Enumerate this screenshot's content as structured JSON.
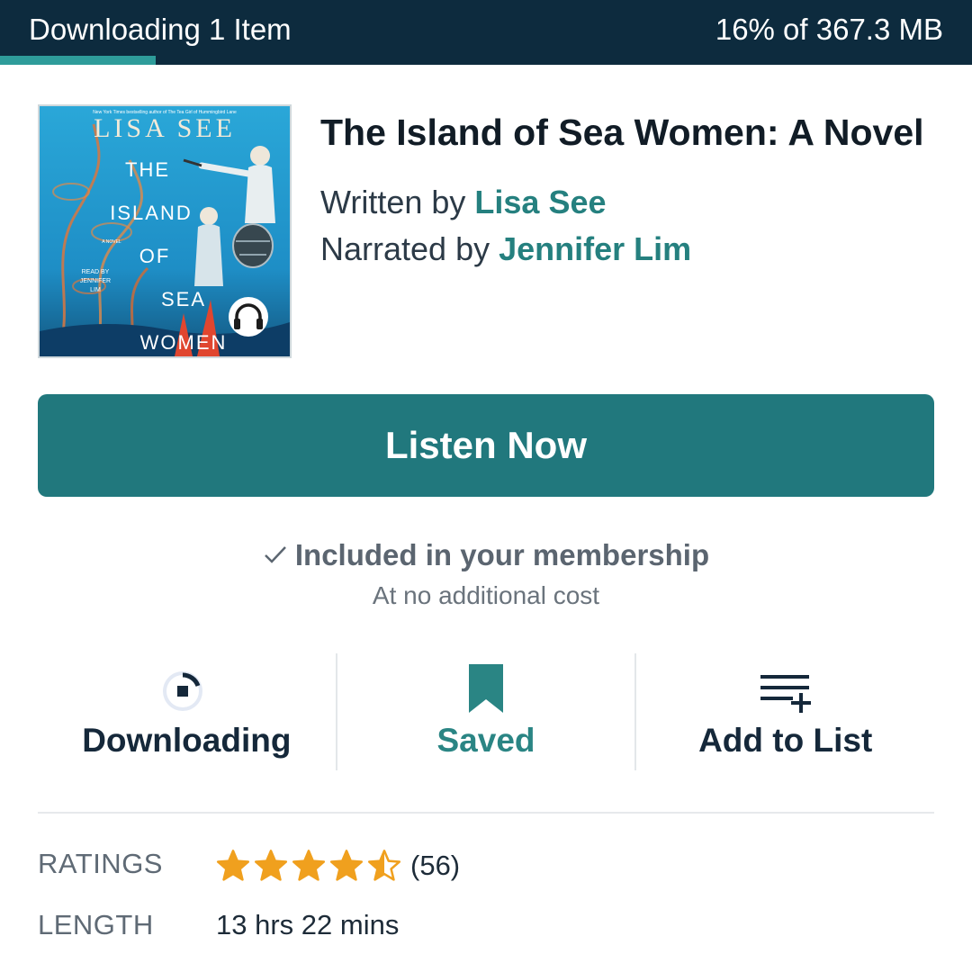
{
  "download_banner": {
    "title": "Downloading 1 Item",
    "status": "16% of 367.3 MB",
    "progress": 0.16,
    "bar_color": "#2e9c9a",
    "bg_color": "#0d2b3e"
  },
  "book": {
    "title": "The Island of Sea Women: A Novel",
    "written_by_label": "Written by",
    "author": "Lisa See",
    "narrated_by_label": "Narrated by",
    "narrator": "Jennifer Lim",
    "cover": {
      "blurb": "New York Times bestselling author of The Tea Girl of Hummingbird Lane",
      "author_text": "LISA SEE",
      "title_lines": [
        "THE",
        "ISLAND",
        "OF",
        "SEA",
        "WOMEN"
      ],
      "novel_tag": "A NOVEL",
      "read_by_lines": [
        "READ BY",
        "JENNIFER",
        "LIM"
      ],
      "badge_icon": "headphones-icon"
    }
  },
  "primary_action": {
    "label": "Listen Now",
    "color": "#21787d"
  },
  "membership": {
    "check_icon": "checkmark-icon",
    "title": "Included in your membership",
    "subtitle": "At no additional cost"
  },
  "actions": [
    {
      "label": "Downloading",
      "icon": "download-progress-icon"
    },
    {
      "label": "Saved",
      "icon": "bookmark-icon"
    },
    {
      "label": "Add to List",
      "icon": "playlist-add-icon"
    }
  ],
  "details": {
    "ratings_label": "RATINGS",
    "ratings_stars": 4.5,
    "ratings_count": "(56)",
    "length_label": "LENGTH",
    "length_value": "13 hrs 22 mins"
  },
  "accent_color": "#2a8584",
  "star_color": "#f0a01e"
}
